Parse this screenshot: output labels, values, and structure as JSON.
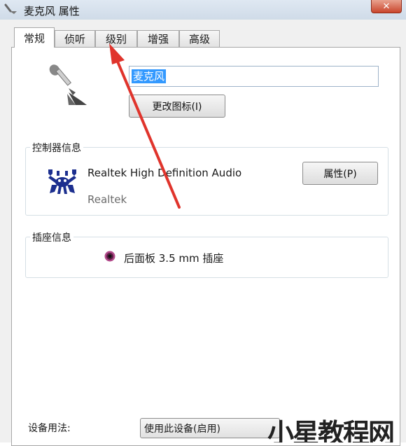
{
  "window": {
    "title": "麦克风 属性",
    "close_label": "✕"
  },
  "tabs": [
    {
      "label": "常规",
      "active": true
    },
    {
      "label": "侦听",
      "active": false
    },
    {
      "label": "级别",
      "active": false
    },
    {
      "label": "增强",
      "active": false
    },
    {
      "label": "高级",
      "active": false
    }
  ],
  "general": {
    "device_name": "麦克风",
    "change_icon_label": "更改图标(I)"
  },
  "controller_info": {
    "heading": "控制器信息",
    "name": "Realtek High Definition Audio",
    "vendor": "Realtek",
    "properties_label": "属性(P)"
  },
  "jack_info": {
    "heading": "插座信息",
    "jack": "后面板 3.5 mm 插座"
  },
  "device_usage": {
    "label": "设备用法:",
    "selected": "使用此设备(启用)"
  },
  "watermark": {
    "text": "小星教程网"
  },
  "colors": {
    "annotation_arrow": "#e0342c",
    "selection": "#3399ff"
  }
}
